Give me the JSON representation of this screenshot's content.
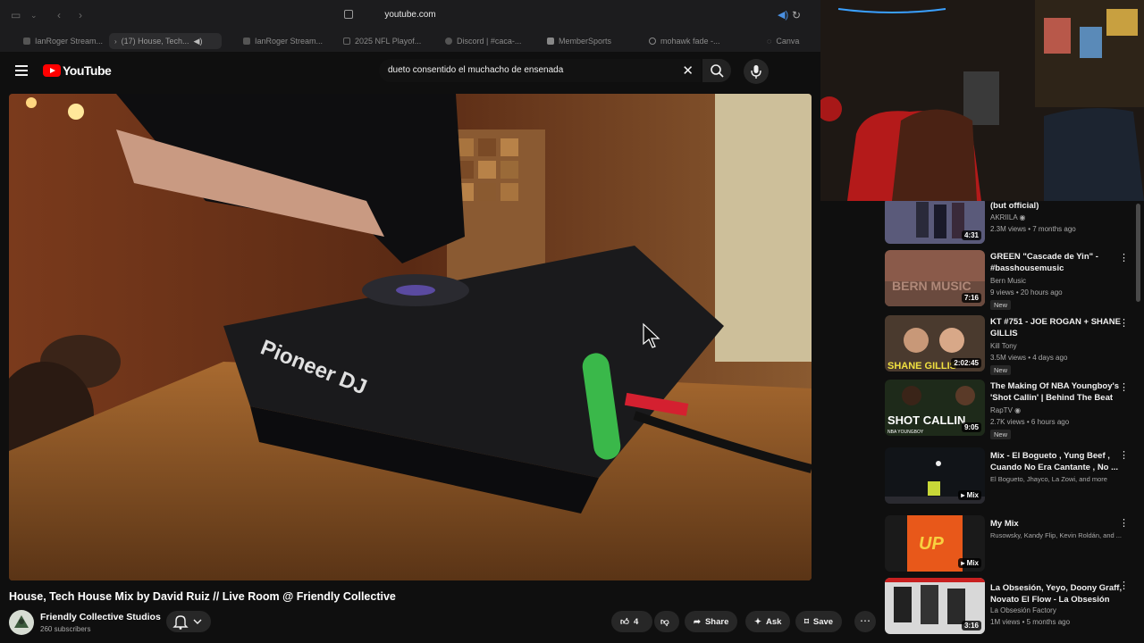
{
  "browser": {
    "url": "youtube.com",
    "tabs": [
      {
        "label": "IanRoger Stream...",
        "active": false
      },
      {
        "label": "(17) House, Tech...",
        "active": true
      },
      {
        "label": "IanRoger Stream...",
        "active": false
      },
      {
        "label": "2025 NFL Playof...",
        "active": false
      },
      {
        "label": "Discord | #caca-...",
        "active": false
      },
      {
        "label": "MemberSports",
        "active": false
      },
      {
        "label": "mohawk fade -...",
        "active": false
      },
      {
        "label": "Canva",
        "active": false
      }
    ]
  },
  "header": {
    "logo_text": "YouTube",
    "search_value": "dueto consentido el muchacho de ensenada"
  },
  "video": {
    "title": "House, Tech House Mix by David Ruiz // Live Room @ Friendly Collective",
    "brand_text": "Pioneer DJ",
    "channel": "Friendly Collective Studios",
    "subscribers": "260 subscribers",
    "likes": "4",
    "share_label": "Share",
    "ask_label": "Ask",
    "save_label": "Save"
  },
  "recommendations": [
    {
      "title": "(but official)",
      "channel": "AKRIILA",
      "verified": true,
      "meta": "2.3M views • 7 months ago",
      "duration": "4:31",
      "new": false
    },
    {
      "title": "GREEN \"Cascade de Yin\" - #basshousemusic",
      "channel": "Bern Music",
      "verified": false,
      "meta": "9 views • 20 hours ago",
      "duration": "7:16",
      "new": true,
      "new_label": "New"
    },
    {
      "title": "KT #751 - JOE ROGAN + SHANE GILLIS",
      "channel": "Kill Tony",
      "verified": false,
      "meta": "3.5M views • 4 days ago",
      "duration": "2:02:45",
      "new": true,
      "new_label": "New",
      "thumb_text": "SHANE GILLIS"
    },
    {
      "title": "The Making Of NBA Youngboy's 'Shot Callin' | Behind The Beat",
      "channel": "RapTV",
      "verified": true,
      "meta": "2.7K views • 6 hours ago",
      "duration": "9:05",
      "new": true,
      "new_label": "New",
      "thumb_text": "SHOT CALLIN",
      "thumb_sub": "NBA YOUNGBOY"
    },
    {
      "title": "Mix - El Bogueto , Yung Beef , Cuando No Era Cantante , No ...",
      "channel": "El Bogueto, Jhayco, La Zowi, and more",
      "verified": false,
      "meta": "",
      "duration": "Mix",
      "new": false
    },
    {
      "title": "My Mix",
      "channel": "Rusowsky, Kandy Flip, Kevin Roldán, and ...",
      "verified": false,
      "meta": "",
      "duration": "Mix",
      "new": false,
      "thumb_text": "UP"
    },
    {
      "title": "La Obsesión, Yeyo, Doony Graff, Novato El Flow - La Obsesión",
      "channel": "La Obsesión Factory",
      "verified": false,
      "meta": "1M views • 5 months ago",
      "duration": "3:16",
      "new": false
    }
  ],
  "colors": {
    "youtube_red": "#ff0000",
    "background": "#0f0f0f",
    "pill_bg": "#272727"
  }
}
